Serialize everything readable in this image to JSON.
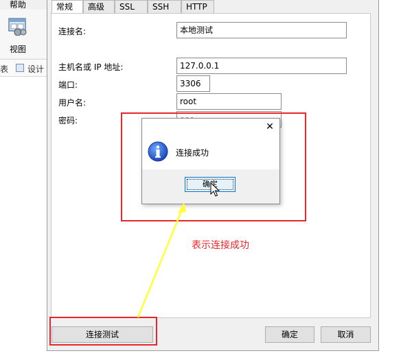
{
  "background_app": {
    "menu_help": "帮助",
    "view_label": "视图",
    "table_label": "表",
    "design_label": "设计"
  },
  "tabs": [
    "常规",
    "高级",
    "SSL",
    "SSH",
    "HTTP"
  ],
  "form": {
    "connection_name_label": "连接名:",
    "connection_name_value": "本地测试",
    "host_label": "主机名或 IP 地址:",
    "host_value": "127.0.0.1",
    "port_label": "端口:",
    "port_value": "3306",
    "username_label": "用户名:",
    "username_value": "root",
    "password_label": "密码:",
    "password_value": "•••"
  },
  "buttons": {
    "test_connection": "连接测试",
    "ok": "确定",
    "cancel": "取消"
  },
  "message_box": {
    "close_glyph": "✕",
    "message": "连接成功",
    "ok": "确定"
  },
  "annotation": {
    "text": "表示连接成功",
    "color": "#e8262a",
    "arrow_color": "#ffff33"
  }
}
